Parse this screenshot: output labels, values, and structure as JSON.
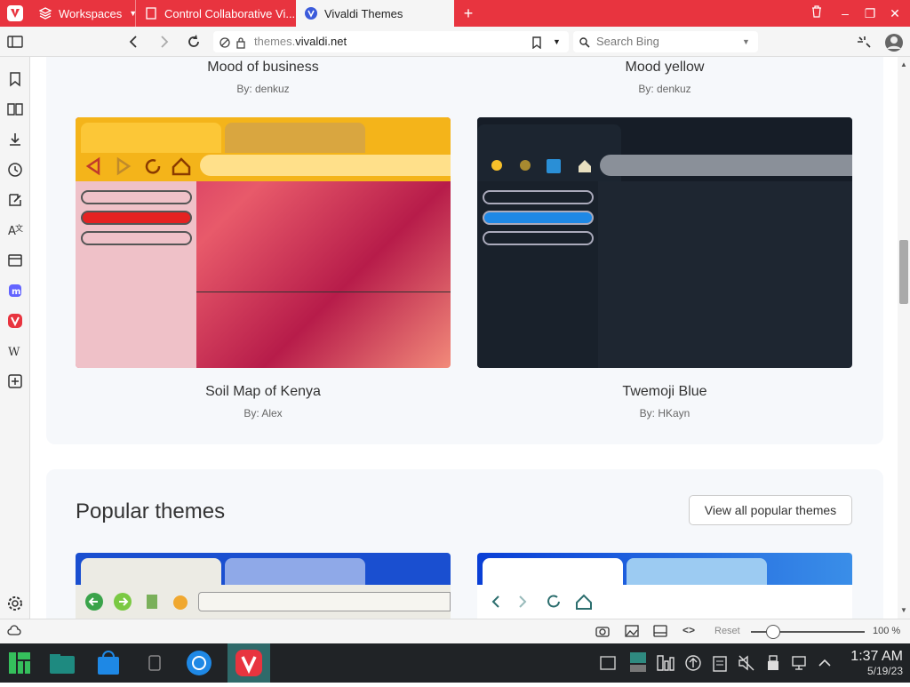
{
  "tabs": [
    {
      "label": "Workspaces",
      "active": false
    },
    {
      "label": "Control Collaborative Vi...",
      "active": false
    },
    {
      "label": "Vivaldi Themes",
      "active": true
    }
  ],
  "address": {
    "prefix": "themes.",
    "domain": "vivaldi.net",
    "search_placeholder": "Search Bing"
  },
  "themes_top": [
    {
      "title": "Mood of business",
      "author": "By: denkuz"
    },
    {
      "title": "Mood yellow",
      "author": "By: denkuz"
    }
  ],
  "themes_mid": [
    {
      "title": "Soil Map of Kenya",
      "author": "By: Alex"
    },
    {
      "title": "Twemoji Blue",
      "author": "By: HKayn"
    }
  ],
  "popular": {
    "heading": "Popular themes",
    "button": "View all popular themes"
  },
  "status": {
    "reset": "Reset",
    "zoom": "100 %"
  },
  "clock": {
    "time": "1:37 AM",
    "date": "5/19/23"
  },
  "colors": {
    "brand": "#e8343f",
    "blue": "#1e88e5"
  }
}
